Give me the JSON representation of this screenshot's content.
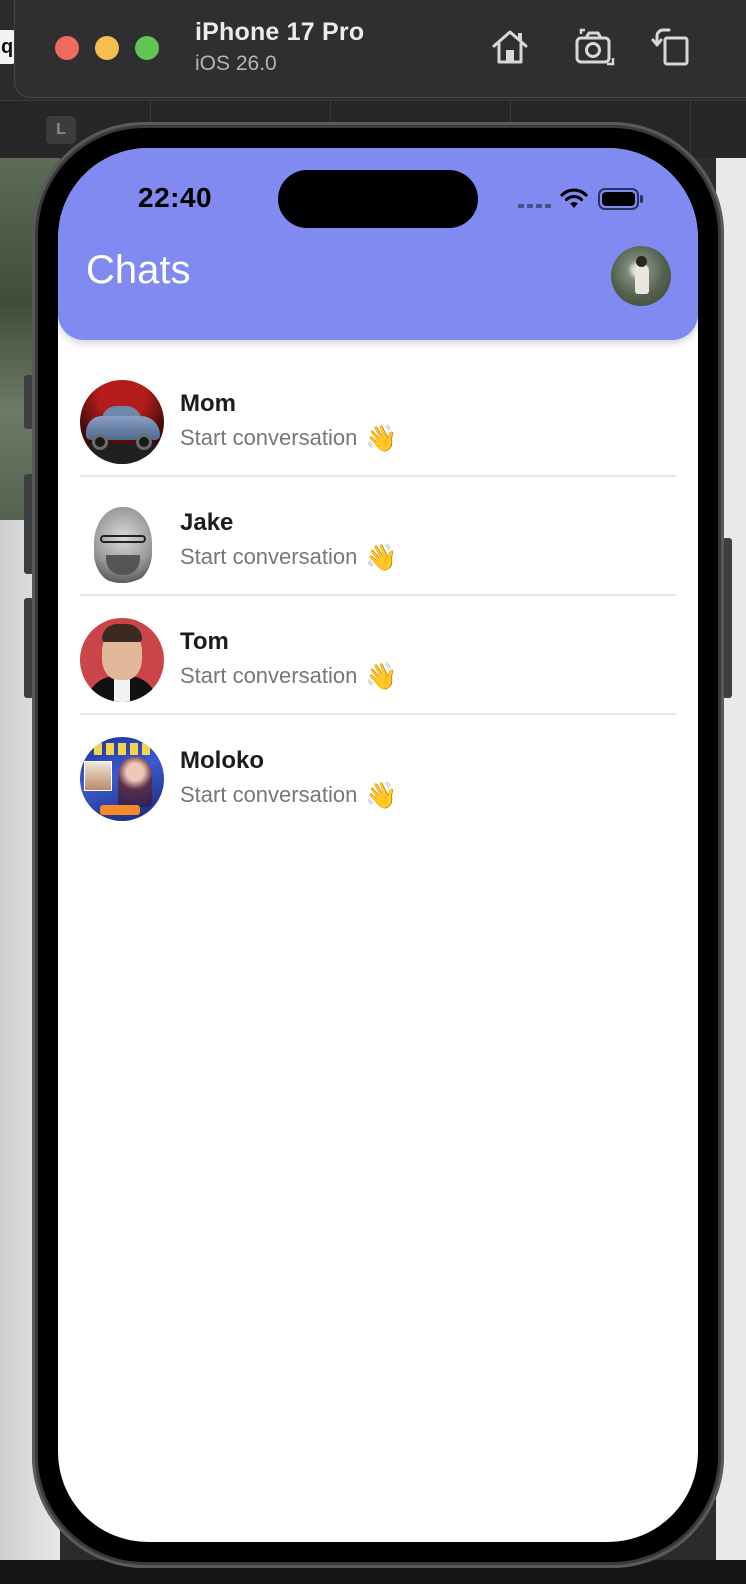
{
  "simulator": {
    "device_name": "iPhone 17 Pro",
    "os_version": "iOS 26.0",
    "toolbar_icons": [
      "home-icon",
      "screenshot-icon",
      "rotate-icon"
    ]
  },
  "background": {
    "tag_letter": "L",
    "edge_letter": "q"
  },
  "status_bar": {
    "time": "22:40",
    "icons": [
      "signal-icon",
      "wifi-icon",
      "battery-icon"
    ]
  },
  "header": {
    "title": "Chats",
    "background_color": "#818af0",
    "title_color": "#ffffff"
  },
  "chats": [
    {
      "name": "Mom",
      "preview": "Start conversation",
      "emoji": "👋",
      "avatar": "car-photo-avatar"
    },
    {
      "name": "Jake",
      "preview": "Start conversation",
      "emoji": "👋",
      "avatar": "portrait-bw-avatar"
    },
    {
      "name": "Tom",
      "preview": "Start conversation",
      "emoji": "👋",
      "avatar": "portrait-suit-avatar"
    },
    {
      "name": "Moloko",
      "preview": "Start conversation",
      "emoji": "👋",
      "avatar": "album-cover-avatar"
    }
  ],
  "colors": {
    "name_text": "#1c1c1e",
    "preview_text": "#77777b",
    "separator": "#e6e6e8"
  }
}
